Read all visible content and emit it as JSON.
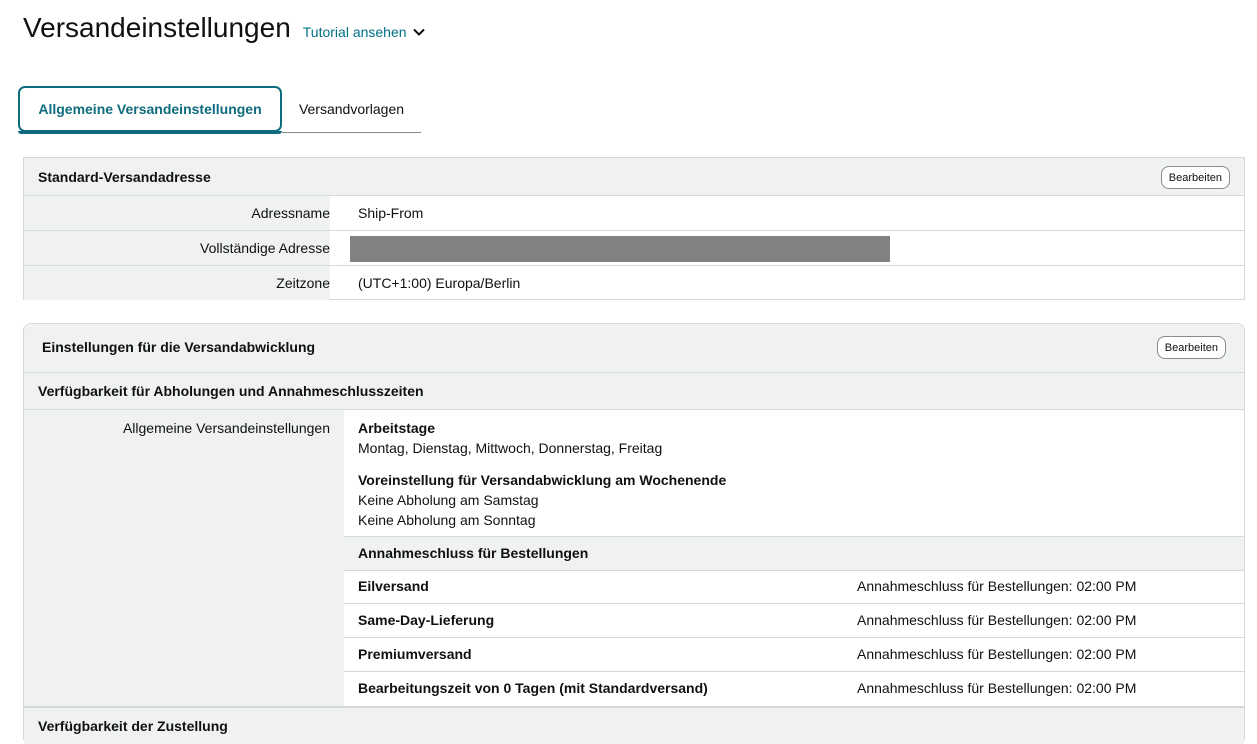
{
  "header": {
    "title": "Versandeinstellungen",
    "tutorial_link": "Tutorial ansehen"
  },
  "tabs": [
    {
      "label": "Allgemeine Versandeinstellungen",
      "active": true
    },
    {
      "label": "Versandvorlagen",
      "active": false
    }
  ],
  "default_address": {
    "heading": "Standard-Versandadresse",
    "edit_label": "Bearbeiten",
    "rows": [
      {
        "label": "Adressname",
        "value": "Ship-From"
      },
      {
        "label": "Vollständige Adresse",
        "value": ""
      },
      {
        "label": "Zeitzone",
        "value": "(UTC+1:00) Europa/Berlin"
      }
    ]
  },
  "fulfillment": {
    "heading": "Einstellungen für die Versandabwicklung",
    "edit_label": "Bearbeiten",
    "pickup_heading": "Verfügbarkeit für Abholungen und Annahmeschlusszeiten",
    "general_label": "Allgemeine Versandeinstellungen",
    "workdays_title": "Arbeitstage",
    "workdays_value": "Montag, Dienstag, Mittwoch, Donnerstag, Freitag",
    "weekend_title": "Voreinstellung für Versandabwicklung am Wochenende",
    "weekend_saturday": "Keine Abholung am Samstag",
    "weekend_sunday": "Keine Abholung am Sonntag",
    "cutoff_heading": "Annahmeschluss für Bestellungen",
    "cutoff_rows": [
      {
        "name": "Eilversand",
        "value": "Annahmeschluss für Bestellungen: 02:00 PM"
      },
      {
        "name": "Same-Day-Lieferung",
        "value": "Annahmeschluss für Bestellungen: 02:00 PM"
      },
      {
        "name": "Premiumversand",
        "value": "Annahmeschluss für Bestellungen: 02:00 PM"
      },
      {
        "name": "Bearbeitungszeit von 0 Tagen (mit Standardversand)",
        "value": "Annahmeschluss für Bestellungen: 02:00 PM"
      }
    ],
    "delivery_heading": "Verfügbarkeit der Zustellung"
  },
  "colors": {
    "accent": "#0f6c7e",
    "link": "#007185",
    "panel_bg": "#f0f2f2",
    "redaction": "#818181"
  }
}
